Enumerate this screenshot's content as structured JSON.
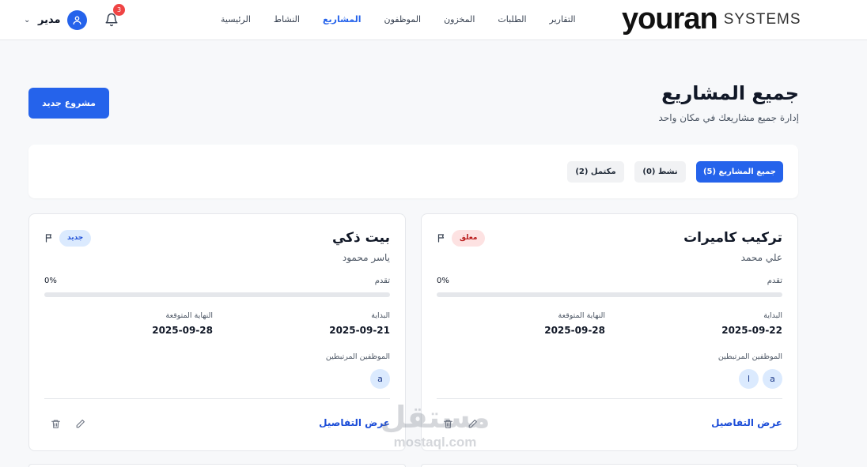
{
  "brand": {
    "main": "youran",
    "sub": "SYSTEMS"
  },
  "nav": {
    "items": [
      {
        "label": "الرئيسية",
        "active": false
      },
      {
        "label": "النشاط",
        "active": false
      },
      {
        "label": "المشاريع",
        "active": true
      },
      {
        "label": "الموظفون",
        "active": false
      },
      {
        "label": "المخزون",
        "active": false
      },
      {
        "label": "الطلبات",
        "active": false
      },
      {
        "label": "التقارير",
        "active": false
      }
    ]
  },
  "notifications": {
    "count": "3",
    "icon": "bell-icon"
  },
  "user": {
    "name": "مدير",
    "icon": "user-icon"
  },
  "header": {
    "title": "جميع المشاريع",
    "subtitle": "إدارة جميع مشاريعك في مكان واحد",
    "new_button": "مشروع جديد"
  },
  "filters": {
    "tabs": [
      {
        "label": "جميع المشاريع (5)",
        "active": true
      },
      {
        "label": "نشط (0)",
        "active": false
      },
      {
        "label": "مكتمل (2)",
        "active": false
      }
    ]
  },
  "projects": [
    {
      "title": "تركيب كاميرات",
      "person": "علي محمد",
      "status": "معلق",
      "status_color": "#b91c1c",
      "progress_label": "تقدم",
      "progress_value": "0%",
      "progress": 0,
      "start_label": "البداية",
      "start_date": "2025-09-22",
      "end_label": "النهاية المتوقعة",
      "end_date": "2025-09-28",
      "employees_label": "الموظفين المرتبطين",
      "employees": [
        "a",
        "l"
      ],
      "details_link": "عرض التفاصيل"
    },
    {
      "title": "بيت ذكي",
      "person": "ياسر محمود",
      "status": "جديد",
      "status_color": "#1d4ed8",
      "progress_label": "تقدم",
      "progress_value": "0%",
      "progress": 0,
      "start_label": "البداية",
      "start_date": "2025-09-21",
      "end_label": "النهاية المتوقعة",
      "end_date": "2025-09-28",
      "employees_label": "الموظفين المرتبطين",
      "employees": [
        "a"
      ],
      "details_link": "عرض التفاصيل"
    }
  ],
  "watermark": {
    "arabic": "مستقل",
    "latin": "mostaql.com"
  },
  "colors": {
    "accent": "#2563eb",
    "background": "#f7f8fa",
    "badge": "#ef4444"
  }
}
